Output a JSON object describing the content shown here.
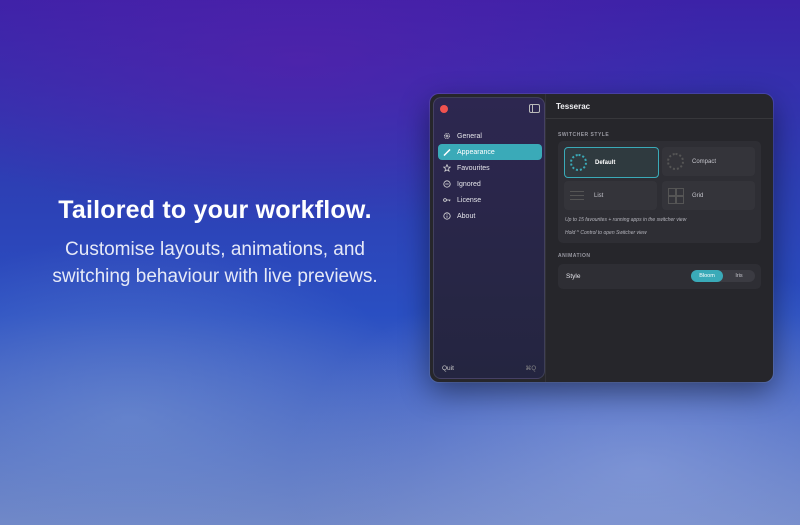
{
  "hero": {
    "title": "Tailored to your workflow.",
    "subtitle_line1": "Customise layouts, animations, and",
    "subtitle_line2": "switching behaviour with live previews."
  },
  "sidebar": {
    "items": [
      {
        "label": "General",
        "icon": "gear-icon"
      },
      {
        "label": "Appearance",
        "icon": "paintbrush-icon",
        "active": true
      },
      {
        "label": "Favourites",
        "icon": "star-icon"
      },
      {
        "label": "Ignored",
        "icon": "minus-circle-icon"
      },
      {
        "label": "License",
        "icon": "key-icon"
      },
      {
        "label": "About",
        "icon": "info-icon"
      }
    ],
    "quit_label": "Quit",
    "quit_shortcut": "⌘Q"
  },
  "main": {
    "title": "Tesserac",
    "switcher_style": {
      "section_label": "SWITCHER STYLE",
      "options": [
        {
          "label": "Default",
          "selected": true
        },
        {
          "label": "Compact"
        },
        {
          "label": "List"
        },
        {
          "label": "Grid"
        }
      ],
      "hint1": "Up to 15 favourites + running apps in the switcher view",
      "hint2": "Hold ^ Control to open Switcher view"
    },
    "animation": {
      "section_label": "ANIMATION",
      "style_label": "Style",
      "options": [
        "Bloom",
        "Iris"
      ],
      "selected": "Bloom"
    }
  },
  "colors": {
    "accent": "#3aaab8",
    "close": "#f0524f"
  }
}
